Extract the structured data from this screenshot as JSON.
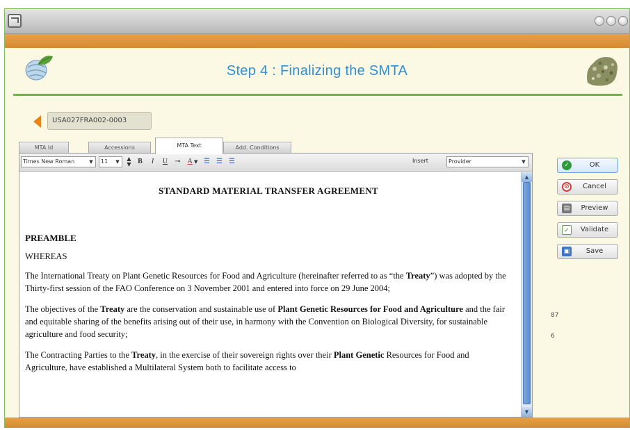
{
  "header": {
    "title": "Step 4 : Finalizing the SMTA"
  },
  "record": {
    "id": "USA027FRA002-0003"
  },
  "tabs": [
    {
      "label": "MTA Id"
    },
    {
      "label": "Accessions"
    },
    {
      "label": "MTA Text"
    },
    {
      "label": "Add. Conditions"
    }
  ],
  "active_tab": "MTA Text",
  "toolbar": {
    "font_family": "Times New Roman",
    "font_size": "11",
    "bold": "B",
    "italic": "I",
    "underline": "U",
    "insert_label": "Insert",
    "insert_value": "Provider"
  },
  "document": {
    "heading": "STANDARD MATERIAL TRANSFER AGREEMENT",
    "preamble": "PREAMBLE",
    "whereas": "WHEREAS",
    "p1_part1": "The International Treaty on Plant Genetic Resources for Food and Agriculture (hereinafter referred to as “the ",
    "p1_bold": "Treaty",
    "p1_part2": "”) was adopted by the Thirty-first session of the FAO Conference on 3 November 2001 and entered into force on 29 June 2004;",
    "p2_part1": "The objectives of the ",
    "p2_bold1": "Treaty",
    "p2_part2": " are the conservation and sustainable use of ",
    "p2_bold2": "Plant Genetic Resources for Food and Agriculture",
    "p2_part3": " and the fair and equitable sharing of the benefits arising out of their use, in harmony with the Convention on Biological Diversity, for sustainable agriculture and food security;",
    "p3_part1": "The Contracting Parties to the ",
    "p3_bold1": "Treaty",
    "p3_part2": ", in the exercise of their sovereign rights over their ",
    "p3_bold2": "Plant Genetic",
    "p3_part3": " Resources for Food and Agriculture, have established a Multilateral System both to facilitate access to"
  },
  "buttons": {
    "ok": "OK",
    "cancel": "Cancel",
    "preview": "Preview",
    "validate": "Validate",
    "save": "Save"
  },
  "side_numbers": [
    "87",
    "6"
  ],
  "colors": {
    "accent_orange": "#d58b30",
    "title_blue": "#2f8fd6",
    "rule_green": "#6fb34a",
    "ok_green": "#2f9a3a",
    "cancel_red": "#d33b3b"
  }
}
